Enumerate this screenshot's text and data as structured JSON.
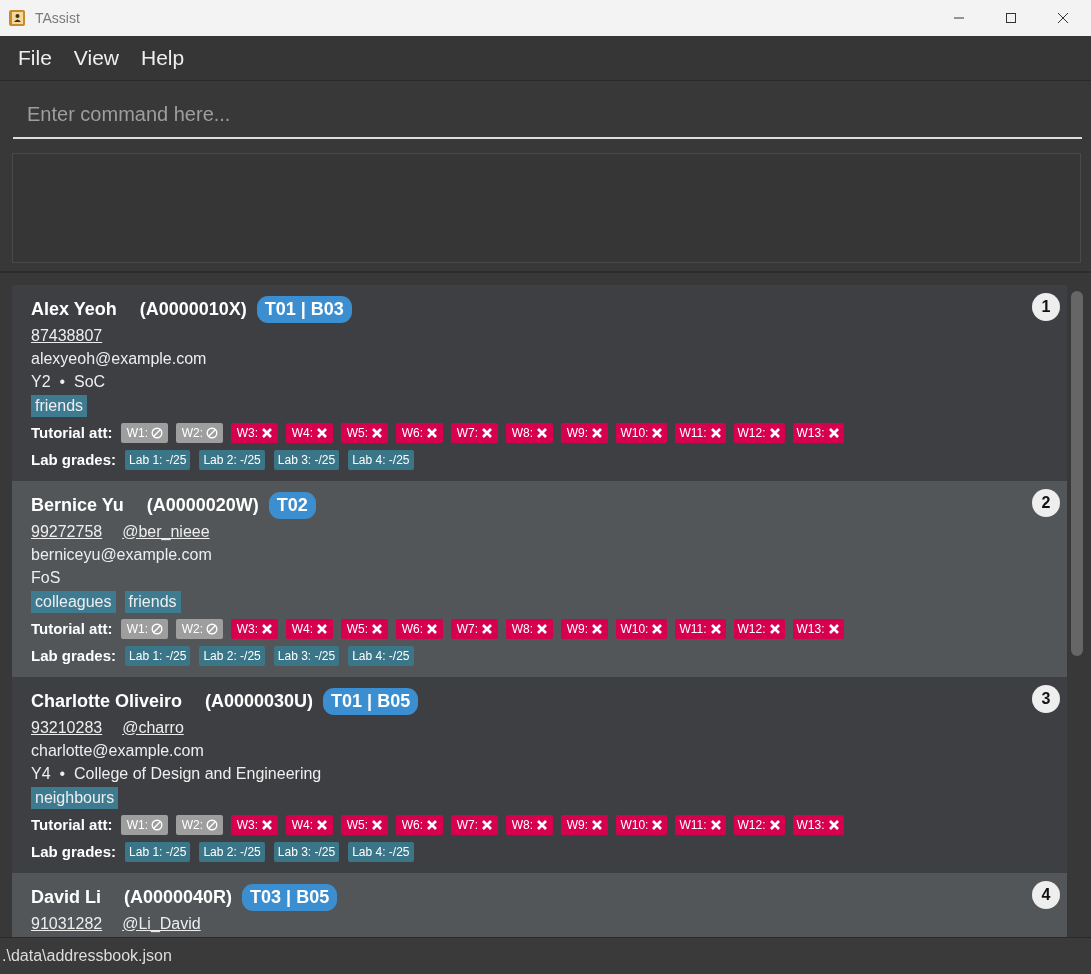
{
  "window": {
    "title": "TAssist"
  },
  "menu": [
    "File",
    "View",
    "Help"
  ],
  "command": {
    "placeholder": "Enter command here..."
  },
  "persons": [
    {
      "index": "1",
      "name": "Alex Yeoh",
      "student_id": "(A0000010X)",
      "group": "T01 | B03",
      "phone": "87438807",
      "email": "alexyeoh@example.com",
      "details": "Y2  •  SoC",
      "tags": [
        "friends"
      ],
      "attendance_label": "Tutorial att:",
      "attendance": [
        {
          "week": "W1:",
          "kind": "excused"
        },
        {
          "week": "W2:",
          "kind": "excused"
        },
        {
          "week": "W3:",
          "kind": "absent"
        },
        {
          "week": "W4:",
          "kind": "absent"
        },
        {
          "week": "W5:",
          "kind": "absent"
        },
        {
          "week": "W6:",
          "kind": "absent"
        },
        {
          "week": "W7:",
          "kind": "absent"
        },
        {
          "week": "W8:",
          "kind": "absent"
        },
        {
          "week": "W9:",
          "kind": "absent"
        },
        {
          "week": "W10:",
          "kind": "absent"
        },
        {
          "week": "W11:",
          "kind": "absent"
        },
        {
          "week": "W12:",
          "kind": "absent"
        },
        {
          "week": "W13:",
          "kind": "absent"
        }
      ],
      "grades_label": "Lab grades:",
      "grades": [
        "Lab 1: -/25",
        "Lab 2: -/25",
        "Lab 3: -/25",
        "Lab 4: -/25"
      ]
    },
    {
      "index": "2",
      "name": "Bernice Yu",
      "student_id": "(A0000020W)",
      "group": "T02",
      "phone": "99272758",
      "telegram": "@ber_nieee",
      "email": "berniceyu@example.com",
      "details": "FoS",
      "tags": [
        "colleagues",
        "friends"
      ],
      "attendance_label": "Tutorial att:",
      "attendance": [
        {
          "week": "W1:",
          "kind": "excused"
        },
        {
          "week": "W2:",
          "kind": "excused"
        },
        {
          "week": "W3:",
          "kind": "absent"
        },
        {
          "week": "W4:",
          "kind": "absent"
        },
        {
          "week": "W5:",
          "kind": "absent"
        },
        {
          "week": "W6:",
          "kind": "absent"
        },
        {
          "week": "W7:",
          "kind": "absent"
        },
        {
          "week": "W8:",
          "kind": "absent"
        },
        {
          "week": "W9:",
          "kind": "absent"
        },
        {
          "week": "W10:",
          "kind": "absent"
        },
        {
          "week": "W11:",
          "kind": "absent"
        },
        {
          "week": "W12:",
          "kind": "absent"
        },
        {
          "week": "W13:",
          "kind": "absent"
        }
      ],
      "grades_label": "Lab grades:",
      "grades": [
        "Lab 1: -/25",
        "Lab 2: -/25",
        "Lab 3: -/25",
        "Lab 4: -/25"
      ]
    },
    {
      "index": "3",
      "name": "Charlotte Oliveiro",
      "student_id": "(A0000030U)",
      "group": "T01 | B05",
      "phone": "93210283",
      "telegram": "@charro",
      "email": "charlotte@example.com",
      "details": "Y4  •  College of Design and Engineering",
      "tags": [
        "neighbours"
      ],
      "attendance_label": "Tutorial att:",
      "attendance": [
        {
          "week": "W1:",
          "kind": "excused"
        },
        {
          "week": "W2:",
          "kind": "excused"
        },
        {
          "week": "W3:",
          "kind": "absent"
        },
        {
          "week": "W4:",
          "kind": "absent"
        },
        {
          "week": "W5:",
          "kind": "absent"
        },
        {
          "week": "W6:",
          "kind": "absent"
        },
        {
          "week": "W7:",
          "kind": "absent"
        },
        {
          "week": "W8:",
          "kind": "absent"
        },
        {
          "week": "W9:",
          "kind": "absent"
        },
        {
          "week": "W10:",
          "kind": "absent"
        },
        {
          "week": "W11:",
          "kind": "absent"
        },
        {
          "week": "W12:",
          "kind": "absent"
        },
        {
          "week": "W13:",
          "kind": "absent"
        }
      ],
      "grades_label": "Lab grades:",
      "grades": [
        "Lab 1: -/25",
        "Lab 2: -/25",
        "Lab 3: -/25",
        "Lab 4: -/25"
      ]
    },
    {
      "index": "4",
      "name": "David Li",
      "student_id": "(A0000040R)",
      "group": "T03 | B05",
      "phone": "91031282",
      "telegram": "@Li_David"
    }
  ],
  "status_bar": ".\\data\\addressbook.json"
}
